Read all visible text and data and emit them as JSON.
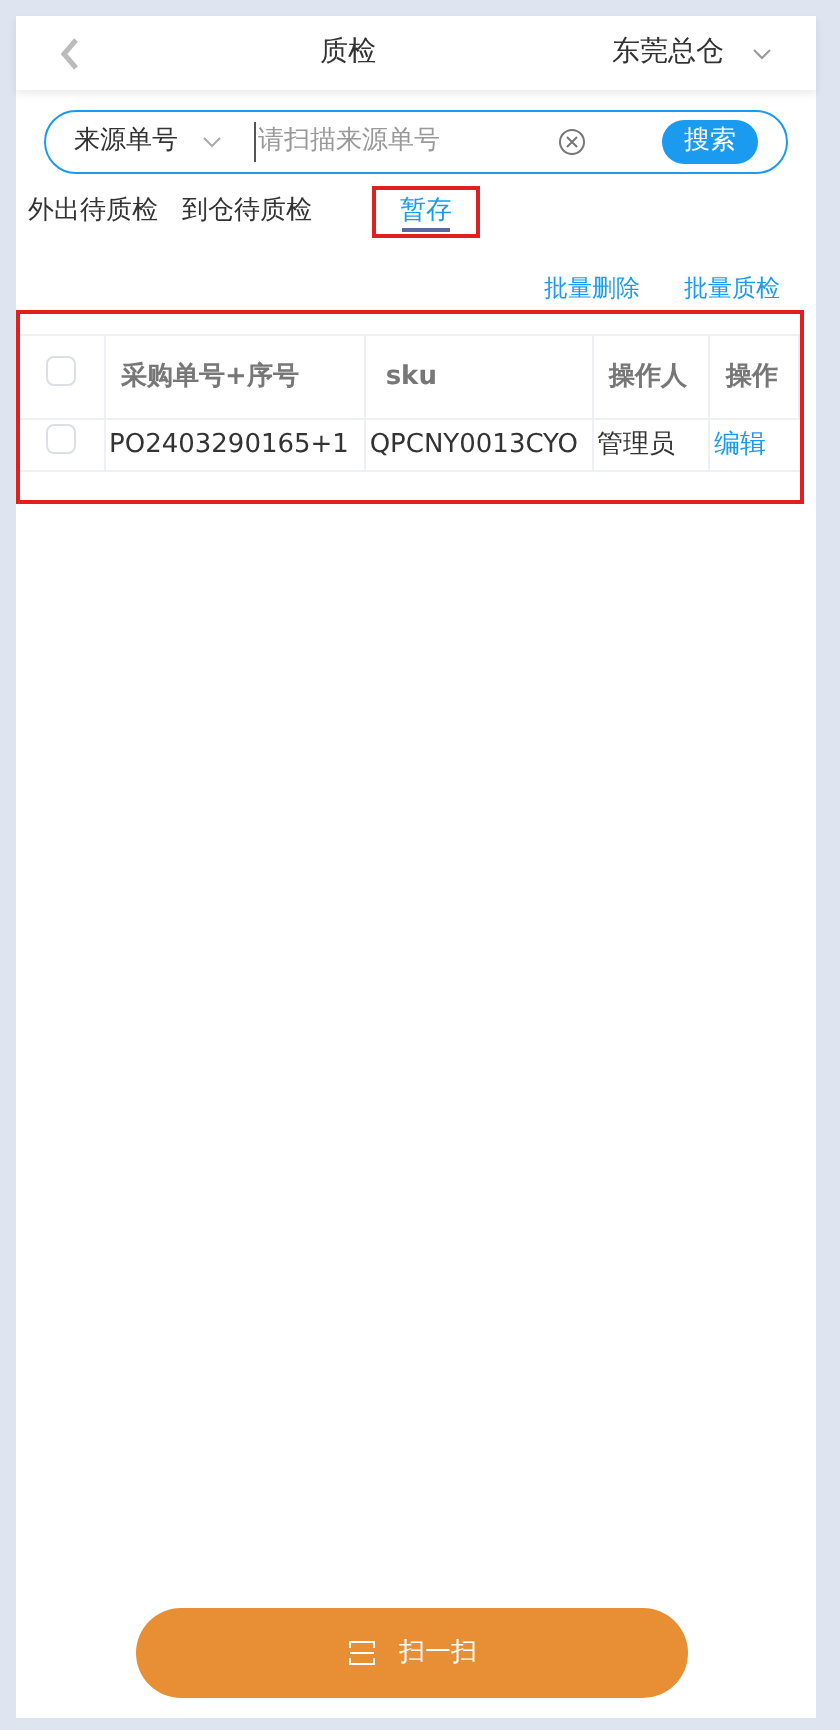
{
  "header": {
    "title": "质检",
    "warehouse": "东莞总仓"
  },
  "search": {
    "source_type": "来源单号",
    "placeholder": "请扫描来源单号",
    "button": "搜索"
  },
  "tabs": [
    {
      "label": "外出待质检",
      "selected": false
    },
    {
      "label": "到仓待质检",
      "selected": false
    },
    {
      "label": "暂存",
      "selected": true
    }
  ],
  "actions": [
    "批量删除",
    "批量质检"
  ],
  "table": {
    "select_all_checked": false,
    "columns": [
      "采购单号+序号",
      "sku",
      "操作人",
      "操作"
    ],
    "rows": [
      {
        "checked": false,
        "cells": [
          "PO2403290165+1",
          "QPCNY0013CYO",
          "管理员"
        ],
        "action": "编辑"
      }
    ]
  },
  "scan_button": "扫一扫"
}
